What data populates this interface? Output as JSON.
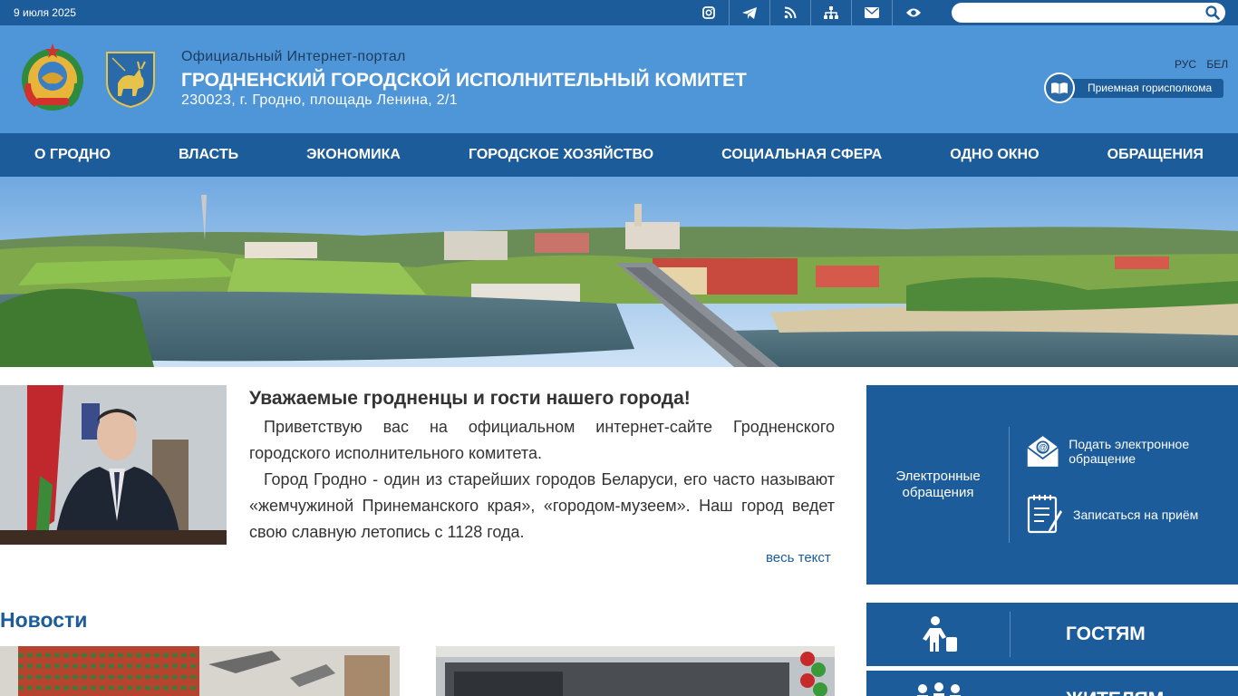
{
  "topbar": {
    "date": "9 июля 2025",
    "icons": [
      "instagram-icon",
      "telegram-icon",
      "rss-icon",
      "sitemap-icon",
      "mail-icon",
      "eye-icon"
    ],
    "search_placeholder": ""
  },
  "header": {
    "subtitle": "Официальный Интернет-портал",
    "title": "ГРОДНЕНСКИЙ ГОРОДСКОЙ ИСПОЛНИТЕЛЬНЫЙ КОМИТЕТ",
    "address": "230023, г. Гродно, площадь Ленина, 2/1",
    "lang": [
      "РУС",
      "БЕЛ"
    ],
    "reception": "Приемная горисполкома"
  },
  "nav": [
    "О ГРОДНО",
    "ВЛАСТЬ",
    "ЭКОНОМИКА",
    "ГОРОДСКОЕ ХОЗЯЙСТВО",
    "СОЦИАЛЬНАЯ СФЕРА",
    "ОДНО ОКНО",
    "ОБРАЩЕНИЯ"
  ],
  "greeting": {
    "title": "Уважаемые гродненцы и гости нашего города!",
    "p1": "Приветствую вас на официальном интернет-сайте Гродненского городского исполнительного комитета.",
    "p2": "Город Гродно - один из старейших городов Беларуси, его часто называют «жемчужиной Принеманского края», «городом-музеем». Наш город ведет свою славную летопись с 1128 года.",
    "more": "весь текст"
  },
  "news": {
    "title": "Новости"
  },
  "epanel": {
    "label": "Электронные обращения",
    "item1": "Подать электронное обращение",
    "item2": "Записаться на приём"
  },
  "guests": {
    "label": "ГОСТЯМ"
  },
  "residents": {
    "label": "ЖИТЕЛЯМ"
  }
}
